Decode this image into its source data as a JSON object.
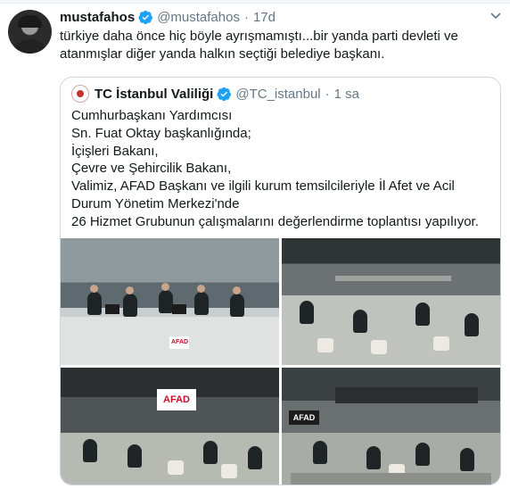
{
  "tweet": {
    "display_name": "mustafahos",
    "handle": "@mustafahos",
    "separator": "·",
    "time": "17d",
    "text": "türkiye daha önce hiç böyle ayrışmamıştı...bir yanda parti devleti ve atanmışlar diğer yanda halkın seçtiği belediye başkanı."
  },
  "quoted": {
    "display_name": "TC İstanbul Valiliği",
    "handle": "@TC_istanbul",
    "separator": "·",
    "time": "1 sa",
    "lines": [
      "Cumhurbaşkanı Yardımcısı",
      "Sn. Fuat Oktay başkanlığında;",
      "İçişleri Bakanı,",
      "Çevre ve Şehircilik Bakanı,",
      "Valimiz, AFAD Başkanı ve ilgili kurum temsilcileriyle İl Afet ve Acil Durum Yönetim Merkezi'nde",
      "26 Hizmet Grubunun çalışmalarını değerlendirme toplantısı yapılıyor."
    ]
  },
  "photos": {
    "sign_afad": "AFAD"
  },
  "colors": {
    "verified": "#1da1f2",
    "secondary_text": "#657786",
    "border": "#ccd6dd"
  },
  "icons": {
    "verified": "verified-badge-icon",
    "more": "chevron-down-icon"
  }
}
